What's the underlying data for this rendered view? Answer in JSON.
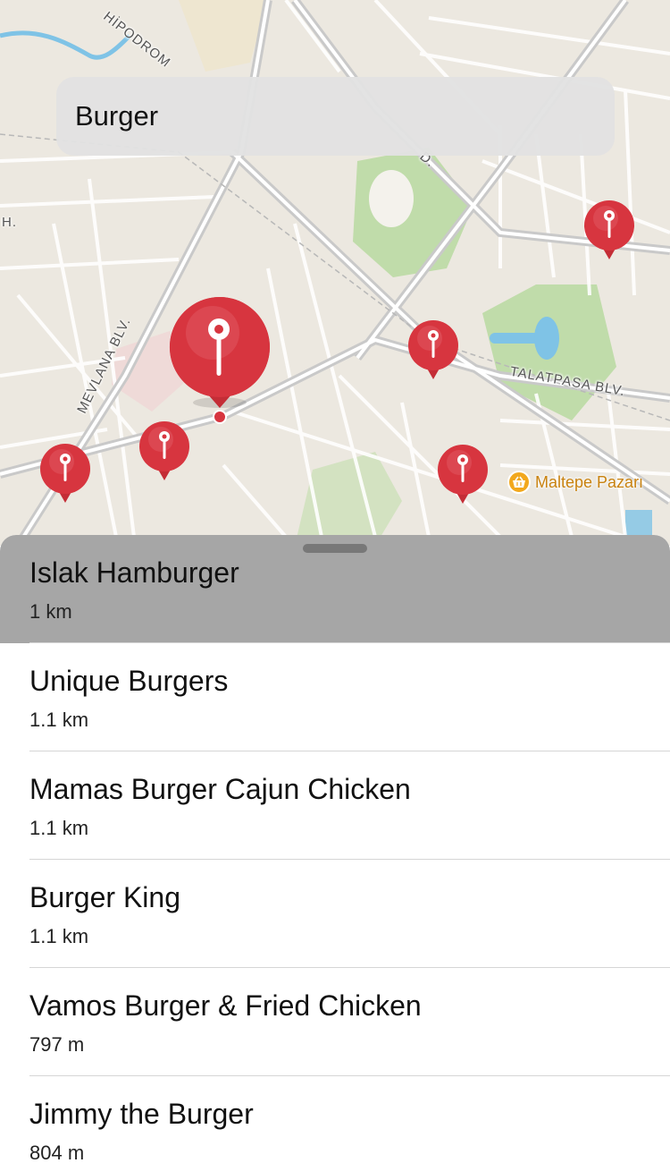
{
  "search": {
    "value": "Burger"
  },
  "map": {
    "street_labels": [
      "HİPODROM",
      "MEVLANA BLV.",
      "TALATPASA BLV.",
      "D.",
      "H."
    ],
    "poi": {
      "label": "Maltepe Pazarı",
      "icon": "basket-icon",
      "color": "#f2a81d"
    },
    "pin_color": "#d7353f",
    "pins": [
      {
        "name": "pin-selected",
        "selected": true
      },
      {
        "name": "pin-top-right",
        "selected": false
      },
      {
        "name": "pin-center",
        "selected": false
      },
      {
        "name": "pin-left",
        "selected": false
      },
      {
        "name": "pin-center-left",
        "selected": false
      },
      {
        "name": "pin-bottom",
        "selected": false
      }
    ]
  },
  "results": [
    {
      "name": "Islak Hamburger",
      "distance": "1 km",
      "selected": true
    },
    {
      "name": "Unique Burgers",
      "distance": "1.1 km",
      "selected": false
    },
    {
      "name": "Mamas Burger Cajun Chicken",
      "distance": "1.1 km",
      "selected": false
    },
    {
      "name": "Burger King",
      "distance": "1.1 km",
      "selected": false
    },
    {
      "name": "Vamos Burger & Fried Chicken",
      "distance": "797 m",
      "selected": false
    },
    {
      "name": "Jimmy the Burger",
      "distance": "804 m",
      "selected": false
    }
  ]
}
